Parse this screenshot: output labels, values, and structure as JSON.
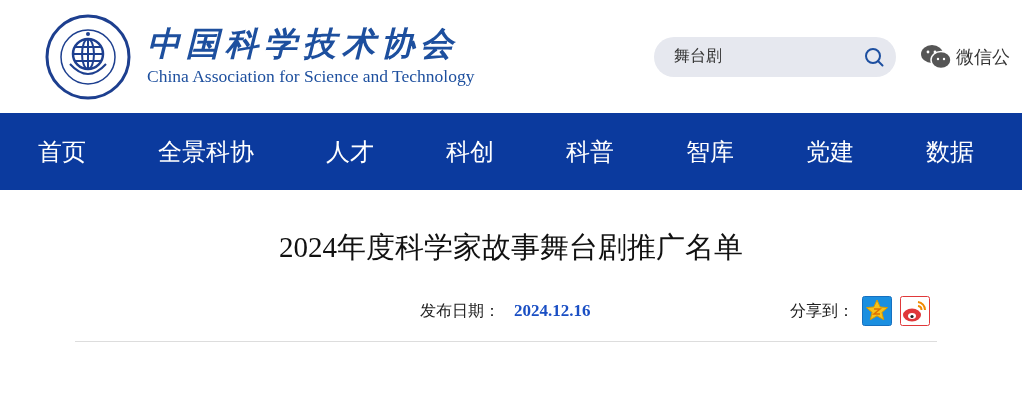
{
  "logo": {
    "name_cn": "中国科学技术协会",
    "name_en": "China Association for Science and Technology"
  },
  "search": {
    "value": "舞台剧"
  },
  "wechat": {
    "label": "微信公"
  },
  "nav": [
    {
      "label": "首页"
    },
    {
      "label": "全景科协"
    },
    {
      "label": "人才"
    },
    {
      "label": "科创"
    },
    {
      "label": "科普"
    },
    {
      "label": "智库"
    },
    {
      "label": "党建"
    },
    {
      "label": "数据"
    }
  ],
  "article": {
    "title": "2024年度科学家故事舞台剧推广名单",
    "date_label": "发布日期：",
    "date": "2024.12.16",
    "share_label": "分享到："
  }
}
